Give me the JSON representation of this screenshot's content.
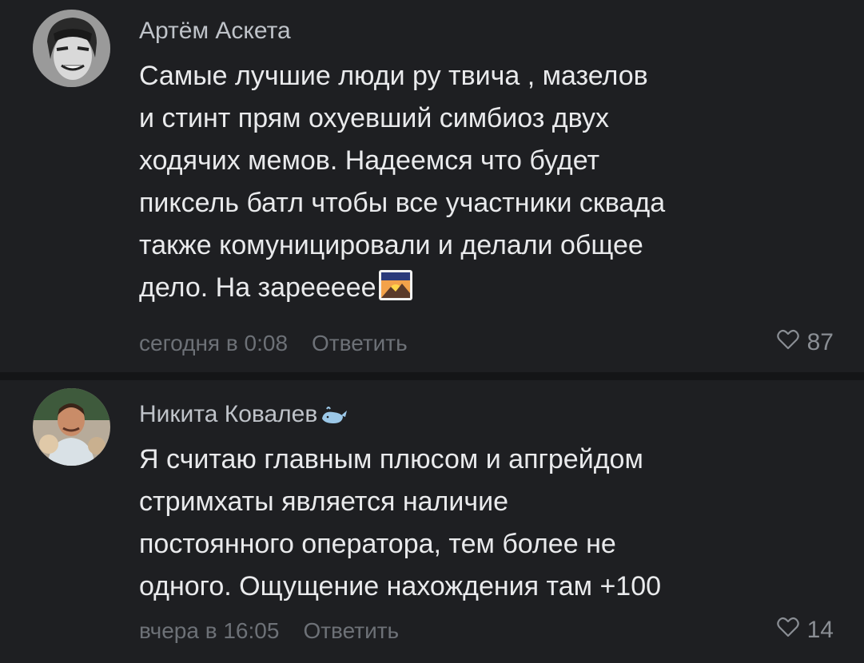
{
  "comments": [
    {
      "author": "Артём Аскета",
      "text_lines": [
        "Самые лучшие люди ру твича , мазелов",
        "и стинт прям охуевший симбиоз двух",
        "ходячих мемов. Надеемся что будет",
        "пиксель батл чтобы все участники сквада",
        "также комуницировали и делали общее",
        "дело. На зареееее"
      ],
      "timestamp": "сегодня в 0:08",
      "reply_label": "Ответить",
      "likes": "87"
    },
    {
      "author": "Никита Ковалев",
      "text_lines": [
        "Я считаю главным плюсом и апгрейдом",
        "стримхаты является наличие",
        "постоянного оператора, тем более не",
        "одного. Ощущение нахождения там +100"
      ],
      "timestamp": "вчера в 16:05",
      "reply_label": "Ответить",
      "likes": "14"
    }
  ],
  "icons": {
    "like": "heart-outline-icon",
    "inline_emoji_1": "sunrise-over-mountains-emoji",
    "author_badge_2": "whale-emoji"
  },
  "colors": {
    "background": "#1e1f22",
    "divider": "#141517",
    "author": "#bfc3c9",
    "text": "#e9eaec",
    "meta": "#6d7177"
  }
}
